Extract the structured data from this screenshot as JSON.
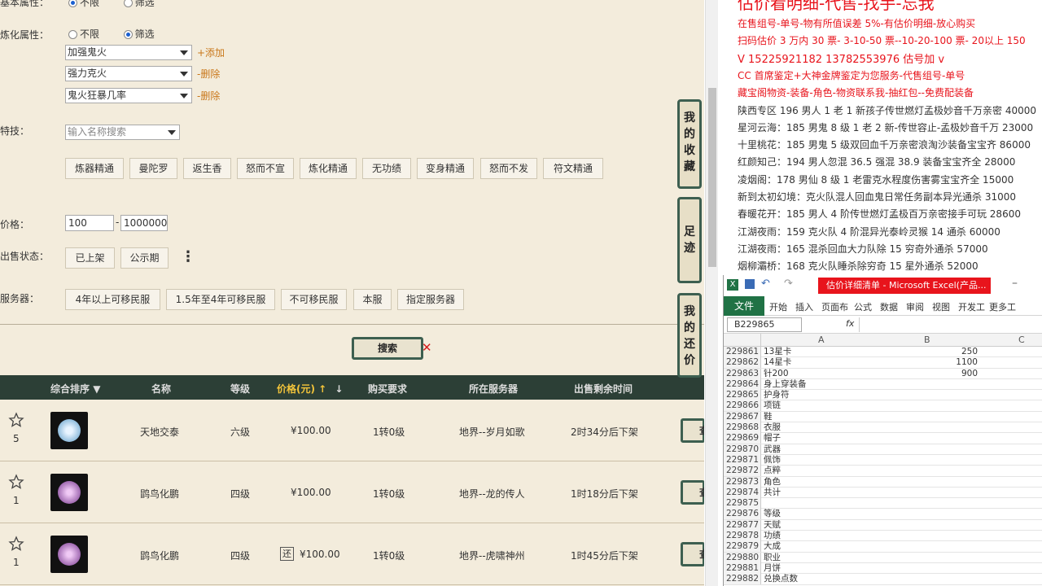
{
  "filters": {
    "basic_attr": {
      "label": "基本属性：",
      "opt1": "不限",
      "opt2": "筛选"
    },
    "refine_attr": {
      "label": "炼化属性：",
      "opt1": "不限",
      "opt2": "筛选"
    },
    "refine_selects": [
      "加强鬼火",
      "强力克火",
      "鬼火狂暴几率"
    ],
    "add_link": "+添加",
    "delete_link": "-删除",
    "skill_label": "特技：",
    "skill_placeholder": "输入名称搜索",
    "skills": [
      "炼器精通",
      "曼陀罗",
      "返生香",
      "怒而不宣",
      "炼化精通",
      "无功绩",
      "变身精通",
      "怒而不发",
      "符文精通"
    ],
    "price_label": "价格：",
    "price_min": "100",
    "price_dash": "-",
    "price_max": "1000000",
    "status_label": "出售状态：",
    "status_options": [
      "已上架",
      "公示期"
    ],
    "more_icon": "⋮",
    "server_label": "服务器：",
    "server_options": [
      "4年以上可移民服",
      "1.5年至4年可移民服",
      "不可移民服",
      "本服",
      "指定服务器"
    ],
    "search_btn": "搜索"
  },
  "side_buttons": {
    "favorites": "我的收藏",
    "footprint": "足迹",
    "bargain": "我的还价"
  },
  "table": {
    "headers": [
      "综合排序",
      "名称",
      "等级",
      "价格(元)",
      "购买要求",
      "所在服务器",
      "出售剩余时间"
    ],
    "view_label": "查",
    "rows": [
      {
        "count": "5",
        "name": "天地交泰",
        "level": "六级",
        "price": "¥100.00",
        "req": "1转0级",
        "server": "地界--岁月如歌",
        "time": "2时34分后下架",
        "tag": ""
      },
      {
        "count": "1",
        "name": "鹍鸟化鹏",
        "level": "四级",
        "price": "¥100.00",
        "req": "1转0级",
        "server": "地界--龙的传人",
        "time": "1时18分后下架",
        "tag": ""
      },
      {
        "count": "1",
        "name": "鹍鸟化鹏",
        "level": "四级",
        "price": "¥100.00",
        "req": "1转0级",
        "server": "地界--虎啸神州",
        "time": "1时45分后下架",
        "tag": "还"
      }
    ]
  },
  "ad": {
    "top_title": "估价看明细-代售-找手-忘我",
    "lines_red": [
      "在售组号-单号-物有所值误差 5%-有估价明细-放心购买",
      "扫码估价 3 万内 30 票- 3-10-50 票--10-20-100 票- 20以上 150",
      "V 15225921182    13782553976    估号加 v",
      "CC 首席鉴定+大神金牌鉴定为您服务-代售组号-单号",
      "藏宝阁物资-装备-角色-物资联系我-抽红包--免费配装备"
    ],
    "lines_black": [
      "陕西专区 196 男人 1 老 1 新孩子传世燃灯孟极妙音千万亲密 40000",
      "星河云海：185 男鬼 8 级 1 老 2 新-传世容止-孟极妙音千万 23000",
      "十里桃花：185 男鬼 5 级双回血千万亲密浪淘沙装备宝宝齐 86000",
      "红颜知己：194 男人忽混 36.5 强混 38.9 装备宝宝齐全 28000",
      "凌烟阁：178 男仙 8 级 1 老雷克水程度伤害雾宝宝齐全 15000",
      "新到太初幻境：克火队混人回血鬼日常任务副本异光通杀 31000",
      "春暖花开：185 男人 4 阶传世燃灯孟极百万亲密接手可玩 28600",
      "江湖夜雨：159 克火队 4 阶混异光泰岭灵猴 14 通杀 60000",
      "江湖夜雨：165 混杀回血大力队除 15 穷奇外通杀 57000",
      "烟柳灞桥：168 克火队睡杀除穷奇 15 星外通杀 52000"
    ]
  },
  "excel": {
    "title": "估价详细清单 - Microsoft Excel(产品...",
    "tabs": [
      "文件",
      "开始",
      "插入",
      "页面布",
      "公式",
      "数据",
      "审阅",
      "视图",
      "开发工",
      "更多工"
    ],
    "namebox": "B229865",
    "fx": "fx",
    "cols": [
      "A",
      "B",
      "C"
    ],
    "rows": [
      {
        "n": "229861",
        "a": "13星卡",
        "b": "250"
      },
      {
        "n": "229862",
        "a": "14星卡",
        "b": "1100"
      },
      {
        "n": "229863",
        "a": "针200",
        "b": "900"
      },
      {
        "n": "229864",
        "a": "身上穿装备",
        "b": ""
      },
      {
        "n": "229865",
        "a": "护身符",
        "b": ""
      },
      {
        "n": "229866",
        "a": "项链",
        "b": ""
      },
      {
        "n": "229867",
        "a": "鞋",
        "b": ""
      },
      {
        "n": "229868",
        "a": "衣服",
        "b": ""
      },
      {
        "n": "229869",
        "a": "帽子",
        "b": ""
      },
      {
        "n": "229870",
        "a": "武器",
        "b": ""
      },
      {
        "n": "229871",
        "a": "佩饰",
        "b": ""
      },
      {
        "n": "229872",
        "a": "点粹",
        "b": ""
      },
      {
        "n": "229873",
        "a": "角色",
        "b": ""
      },
      {
        "n": "229874",
        "a": "共计",
        "b": ""
      },
      {
        "n": "229875",
        "a": "",
        "b": ""
      },
      {
        "n": "229876",
        "a": "等级",
        "b": ""
      },
      {
        "n": "229877",
        "a": "天赋",
        "b": ""
      },
      {
        "n": "229878",
        "a": "功绩",
        "b": ""
      },
      {
        "n": "229879",
        "a": "大成",
        "b": ""
      },
      {
        "n": "229880",
        "a": "职业",
        "b": ""
      },
      {
        "n": "229881",
        "a": "月饼",
        "b": ""
      },
      {
        "n": "229882",
        "a": "兑换点数",
        "b": ""
      }
    ]
  },
  "colors": {
    "accent_green": "#3d5f50",
    "ad_red": "#e8141c",
    "excel_green": "#207245",
    "link_orange": "#c9771a"
  }
}
